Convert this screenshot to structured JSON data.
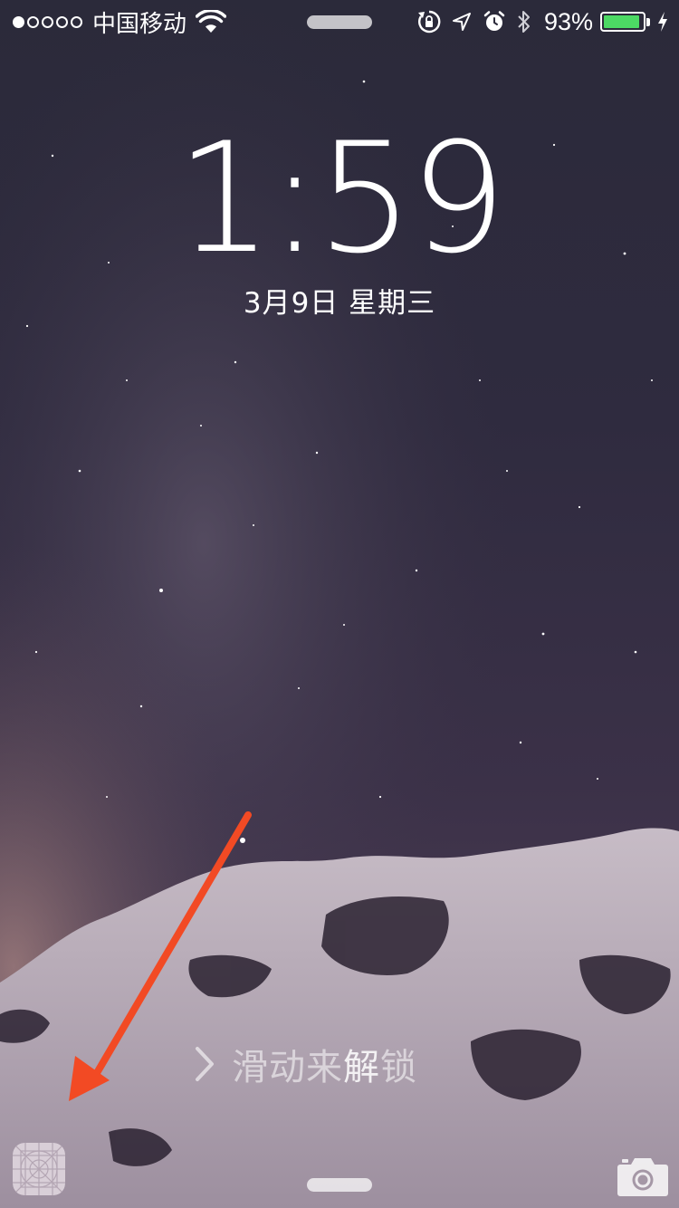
{
  "status_bar": {
    "carrier": "中国移动",
    "signal_bars_filled": 1,
    "signal_bars_total": 5,
    "battery_percent_text": "93%",
    "battery_level": 0.93,
    "battery_color": "#4cd964",
    "icons": [
      "signal-dots-icon",
      "wifi-icon",
      "orientation-lock-icon",
      "location-arrow-icon",
      "alarm-icon",
      "bluetooth-icon",
      "battery-icon",
      "charging-bolt-icon"
    ]
  },
  "lock_screen": {
    "time": "1:59",
    "date": "3月9日 星期三",
    "slide_to_unlock": "滑动来解锁",
    "slide_to_unlock_parts": [
      "滑动来",
      "解",
      "锁"
    ]
  },
  "bottom": {
    "left_icon": "app-placeholder-icon",
    "right_icon": "camera-icon"
  },
  "annotation": {
    "arrow_color": "#f24a24"
  }
}
